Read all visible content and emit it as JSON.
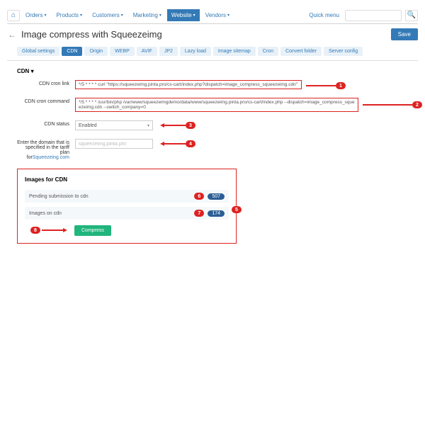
{
  "nav": {
    "orders": "Orders",
    "products": "Products",
    "customers": "Customers",
    "marketing": "Marketing",
    "website": "Website",
    "vendors": "Vendors",
    "quickmenu": "Quick menu"
  },
  "page": {
    "title": "Image compress with Squeezeimg",
    "save": "Save"
  },
  "tabs": [
    "Global settings",
    "CDN",
    "Origin",
    "WEBP",
    "AVIF",
    "JP2",
    "Lazy load",
    "Image sitemap",
    "Cron",
    "Convert folder",
    "Server config"
  ],
  "section": "CDN",
  "fields": {
    "cronlink_lbl": "CDN cron link",
    "cronlink_val": "*/5 * * * * curl \"https://squeezeimg.pinta.pro/cs-cart/index.php?dispatch=image_compress_squeezeimg.cdn\"",
    "croncmd_lbl": "CDN cron command",
    "croncmd_val": "*/5 * * * * /usr/bin/php /var/www/squeezeimgdemo/data/www/squeezeimg.pinta.pro/cs-cart/index.php --dispatch=image_compress_squeezeimg.cdn --switch_company=0",
    "status_lbl": "CDN status",
    "status_val": "Enabled",
    "domain_lbl": "Enter the domain that is specified in the tariff plan for",
    "domain_link": "Squeezeing.com",
    "domain_val": "squeezeimg.pinta.pro"
  },
  "callouts": {
    "c1": "1",
    "c2": "2",
    "c3": "3",
    "c4": "4",
    "c5": "5",
    "c6": "6",
    "c7": "7",
    "c8": "8"
  },
  "panel": {
    "title": "Images for CDN",
    "pending_lbl": "Pending submission to cdn",
    "pending_badge": "507",
    "oncdn_lbl": "Images on cdn",
    "oncdn_badge": "174",
    "compress": "Compress"
  }
}
